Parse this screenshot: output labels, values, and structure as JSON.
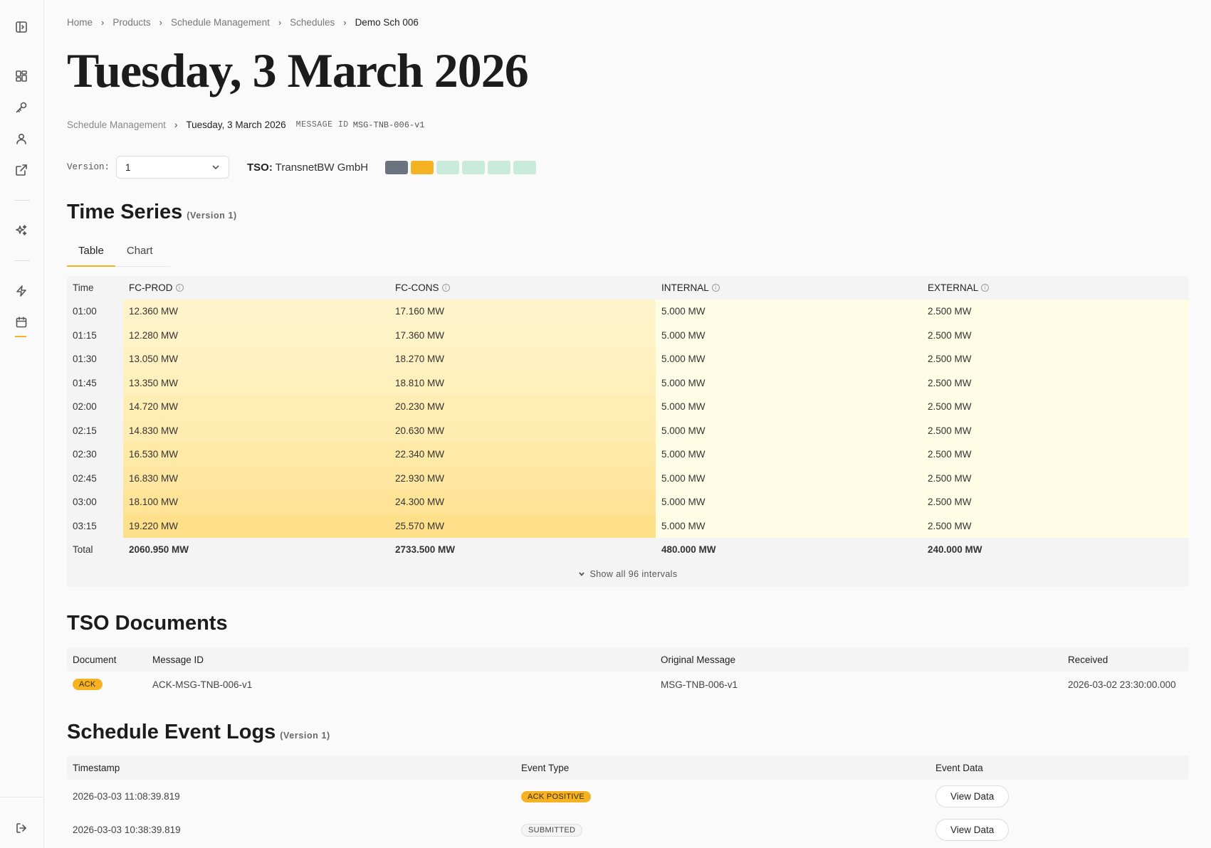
{
  "breadcrumb": [
    "Home",
    "Products",
    "Schedule Management",
    "Schedules",
    "Demo Sch 006"
  ],
  "page_title": "Tuesday, 3 March 2026",
  "sub_breadcrumb": {
    "parent": "Schedule Management",
    "current": "Tuesday, 3 March 2026",
    "message_id_label": "MESSAGE ID",
    "message_id": "MSG-TNB-006-v1"
  },
  "version": {
    "label": "Version:",
    "selected": "1"
  },
  "tso": {
    "label": "TSO:",
    "name": "TransnetBW GmbH"
  },
  "status_swatches": [
    "#6b7280",
    "#f5b323",
    "#c9ebdc",
    "#c9ebdc",
    "#c9ebdc",
    "#c9ebdc"
  ],
  "time_series": {
    "title": "Time Series",
    "version_note": "(Version 1)",
    "tabs": [
      "Table",
      "Chart"
    ],
    "active_tab": "Table",
    "columns": [
      "Time",
      "FC-PROD",
      "FC-CONS",
      "INTERNAL",
      "EXTERNAL"
    ],
    "rows": [
      {
        "time": "01:00",
        "prod": "12.360 MW",
        "cons": "17.160 MW",
        "internal": "5.000 MW",
        "external": "2.500 MW",
        "intensity": 0.1
      },
      {
        "time": "01:15",
        "prod": "12.280 MW",
        "cons": "17.360 MW",
        "internal": "5.000 MW",
        "external": "2.500 MW",
        "intensity": 0.12
      },
      {
        "time": "01:30",
        "prod": "13.050 MW",
        "cons": "18.270 MW",
        "internal": "5.000 MW",
        "external": "2.500 MW",
        "intensity": 0.22
      },
      {
        "time": "01:45",
        "prod": "13.350 MW",
        "cons": "18.810 MW",
        "internal": "5.000 MW",
        "external": "2.500 MW",
        "intensity": 0.28
      },
      {
        "time": "02:00",
        "prod": "14.720 MW",
        "cons": "20.230 MW",
        "internal": "5.000 MW",
        "external": "2.500 MW",
        "intensity": 0.4
      },
      {
        "time": "02:15",
        "prod": "14.830 MW",
        "cons": "20.630 MW",
        "internal": "5.000 MW",
        "external": "2.500 MW",
        "intensity": 0.45
      },
      {
        "time": "02:30",
        "prod": "16.530 MW",
        "cons": "22.340 MW",
        "internal": "5.000 MW",
        "external": "2.500 MW",
        "intensity": 0.6
      },
      {
        "time": "02:45",
        "prod": "16.830 MW",
        "cons": "22.930 MW",
        "internal": "5.000 MW",
        "external": "2.500 MW",
        "intensity": 0.66
      },
      {
        "time": "03:00",
        "prod": "18.100 MW",
        "cons": "24.300 MW",
        "internal": "5.000 MW",
        "external": "2.500 MW",
        "intensity": 0.82
      },
      {
        "time": "03:15",
        "prod": "19.220 MW",
        "cons": "25.570 MW",
        "internal": "5.000 MW",
        "external": "2.500 MW",
        "intensity": 1.0
      }
    ],
    "total": {
      "label": "Total",
      "prod": "2060.950 MW",
      "cons": "2733.500 MW",
      "internal": "480.000 MW",
      "external": "240.000 MW"
    },
    "show_all": "Show all 96 intervals"
  },
  "tso_documents": {
    "title": "TSO Documents",
    "columns": [
      "Document",
      "Message ID",
      "Original Message",
      "Received"
    ],
    "rows": [
      {
        "document": "ACK",
        "message_id": "ACK-MSG-TNB-006-v1",
        "original": "MSG-TNB-006-v1",
        "received": "2026-03-02 23:30:00.000"
      }
    ]
  },
  "event_logs": {
    "title": "Schedule Event Logs",
    "version_note": "(Version 1)",
    "columns": [
      "Timestamp",
      "Event Type",
      "Event Data"
    ],
    "rows": [
      {
        "timestamp": "2026-03-03 11:08:39.819",
        "event_type": "ACK POSITIVE",
        "style": "ack",
        "action": "View Data"
      },
      {
        "timestamp": "2026-03-03 10:38:39.819",
        "event_type": "SUBMITTED",
        "style": "sub",
        "action": "View Data"
      }
    ]
  },
  "colors": {
    "accent": "#f5b323",
    "heat_low": "#fff6d0",
    "heat_high": "#ffe08a",
    "flat_fill": "#fffde6"
  }
}
